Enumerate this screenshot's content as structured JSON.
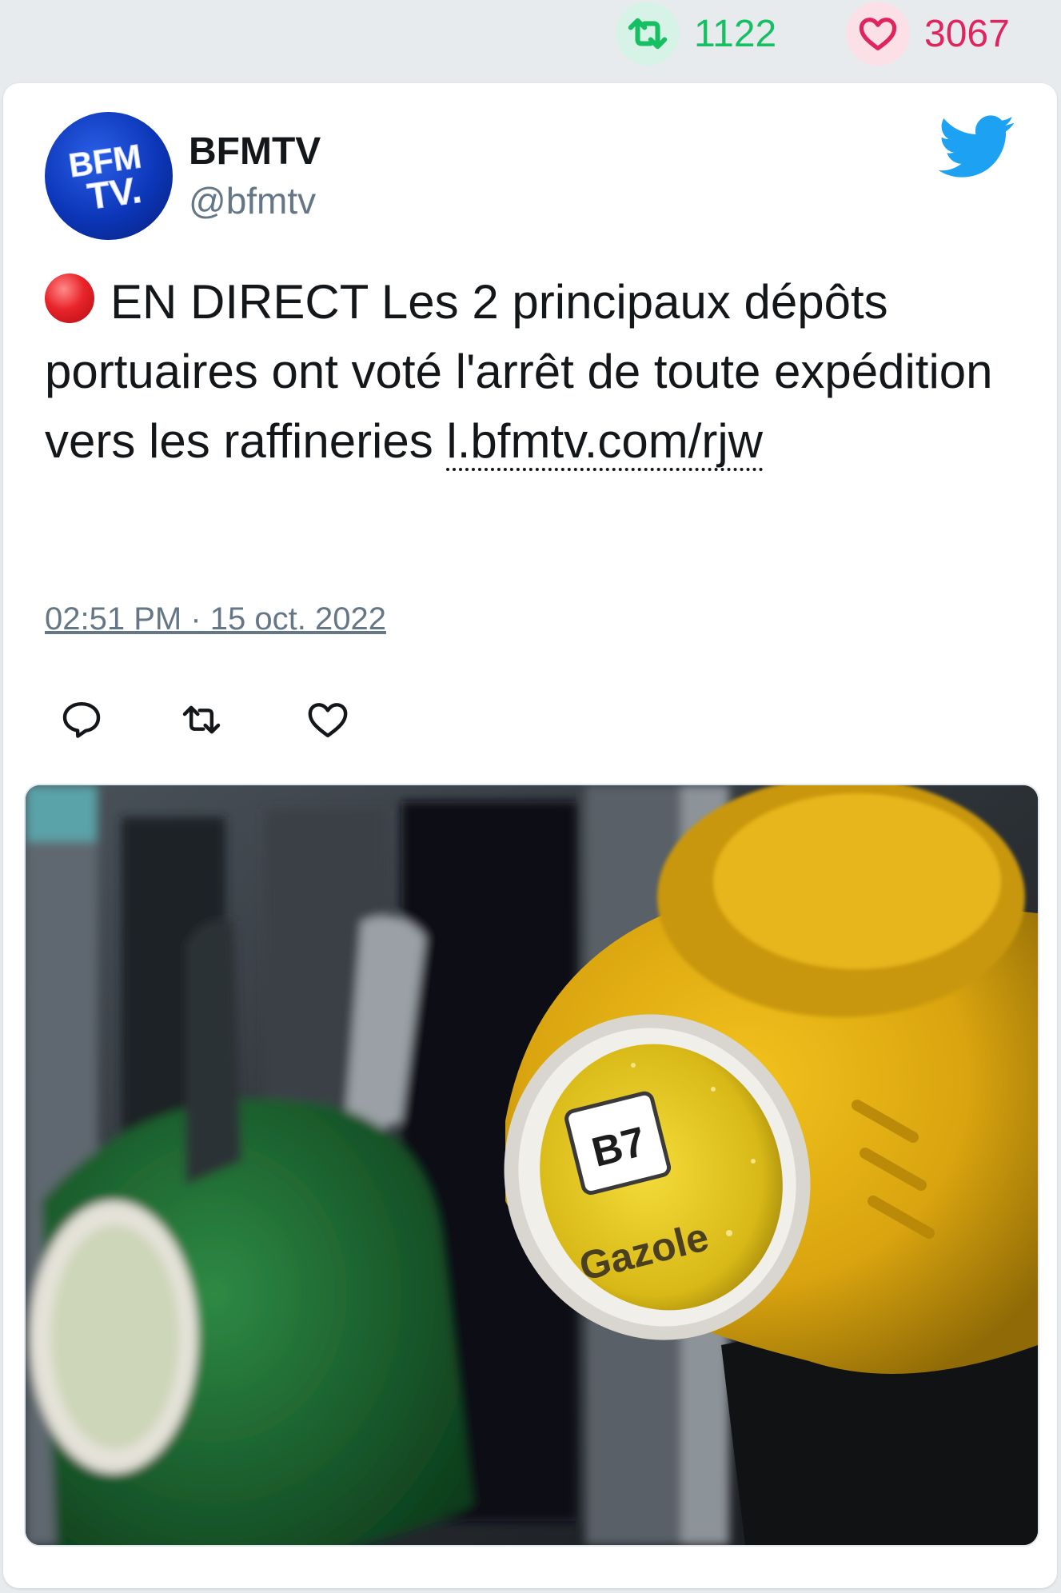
{
  "stats": {
    "retweets": "1122",
    "likes": "3067",
    "retweet_icon": "retweet-icon",
    "like_icon": "heart-icon"
  },
  "tweet": {
    "author_name": "BFMTV",
    "author_handle": "@bfmtv",
    "avatar_logo_text": "BFM TV.",
    "text": "EN DIRECT Les 2 principaux dépôts portuaires ont voté l'arrêt de toute expédition vers les raffineries ",
    "link_text": "l.bfmtv.com/rjw",
    "timestamp": "02:51 PM · 15 oct. 2022",
    "live_icon": "red-circle-icon",
    "platform_icon": "twitter-bird-icon"
  },
  "actions": {
    "reply_icon": "reply-icon",
    "retweet_icon": "retweet-icon",
    "like_icon": "heart-icon"
  },
  "media": {
    "nozzle_badge": "B7",
    "nozzle_label": "Gazole"
  },
  "colors": {
    "retweet": "#17bf63",
    "like": "#e0245e",
    "twitter_blue": "#1da1f2",
    "text_primary": "#14171a",
    "text_secondary": "#657786"
  }
}
